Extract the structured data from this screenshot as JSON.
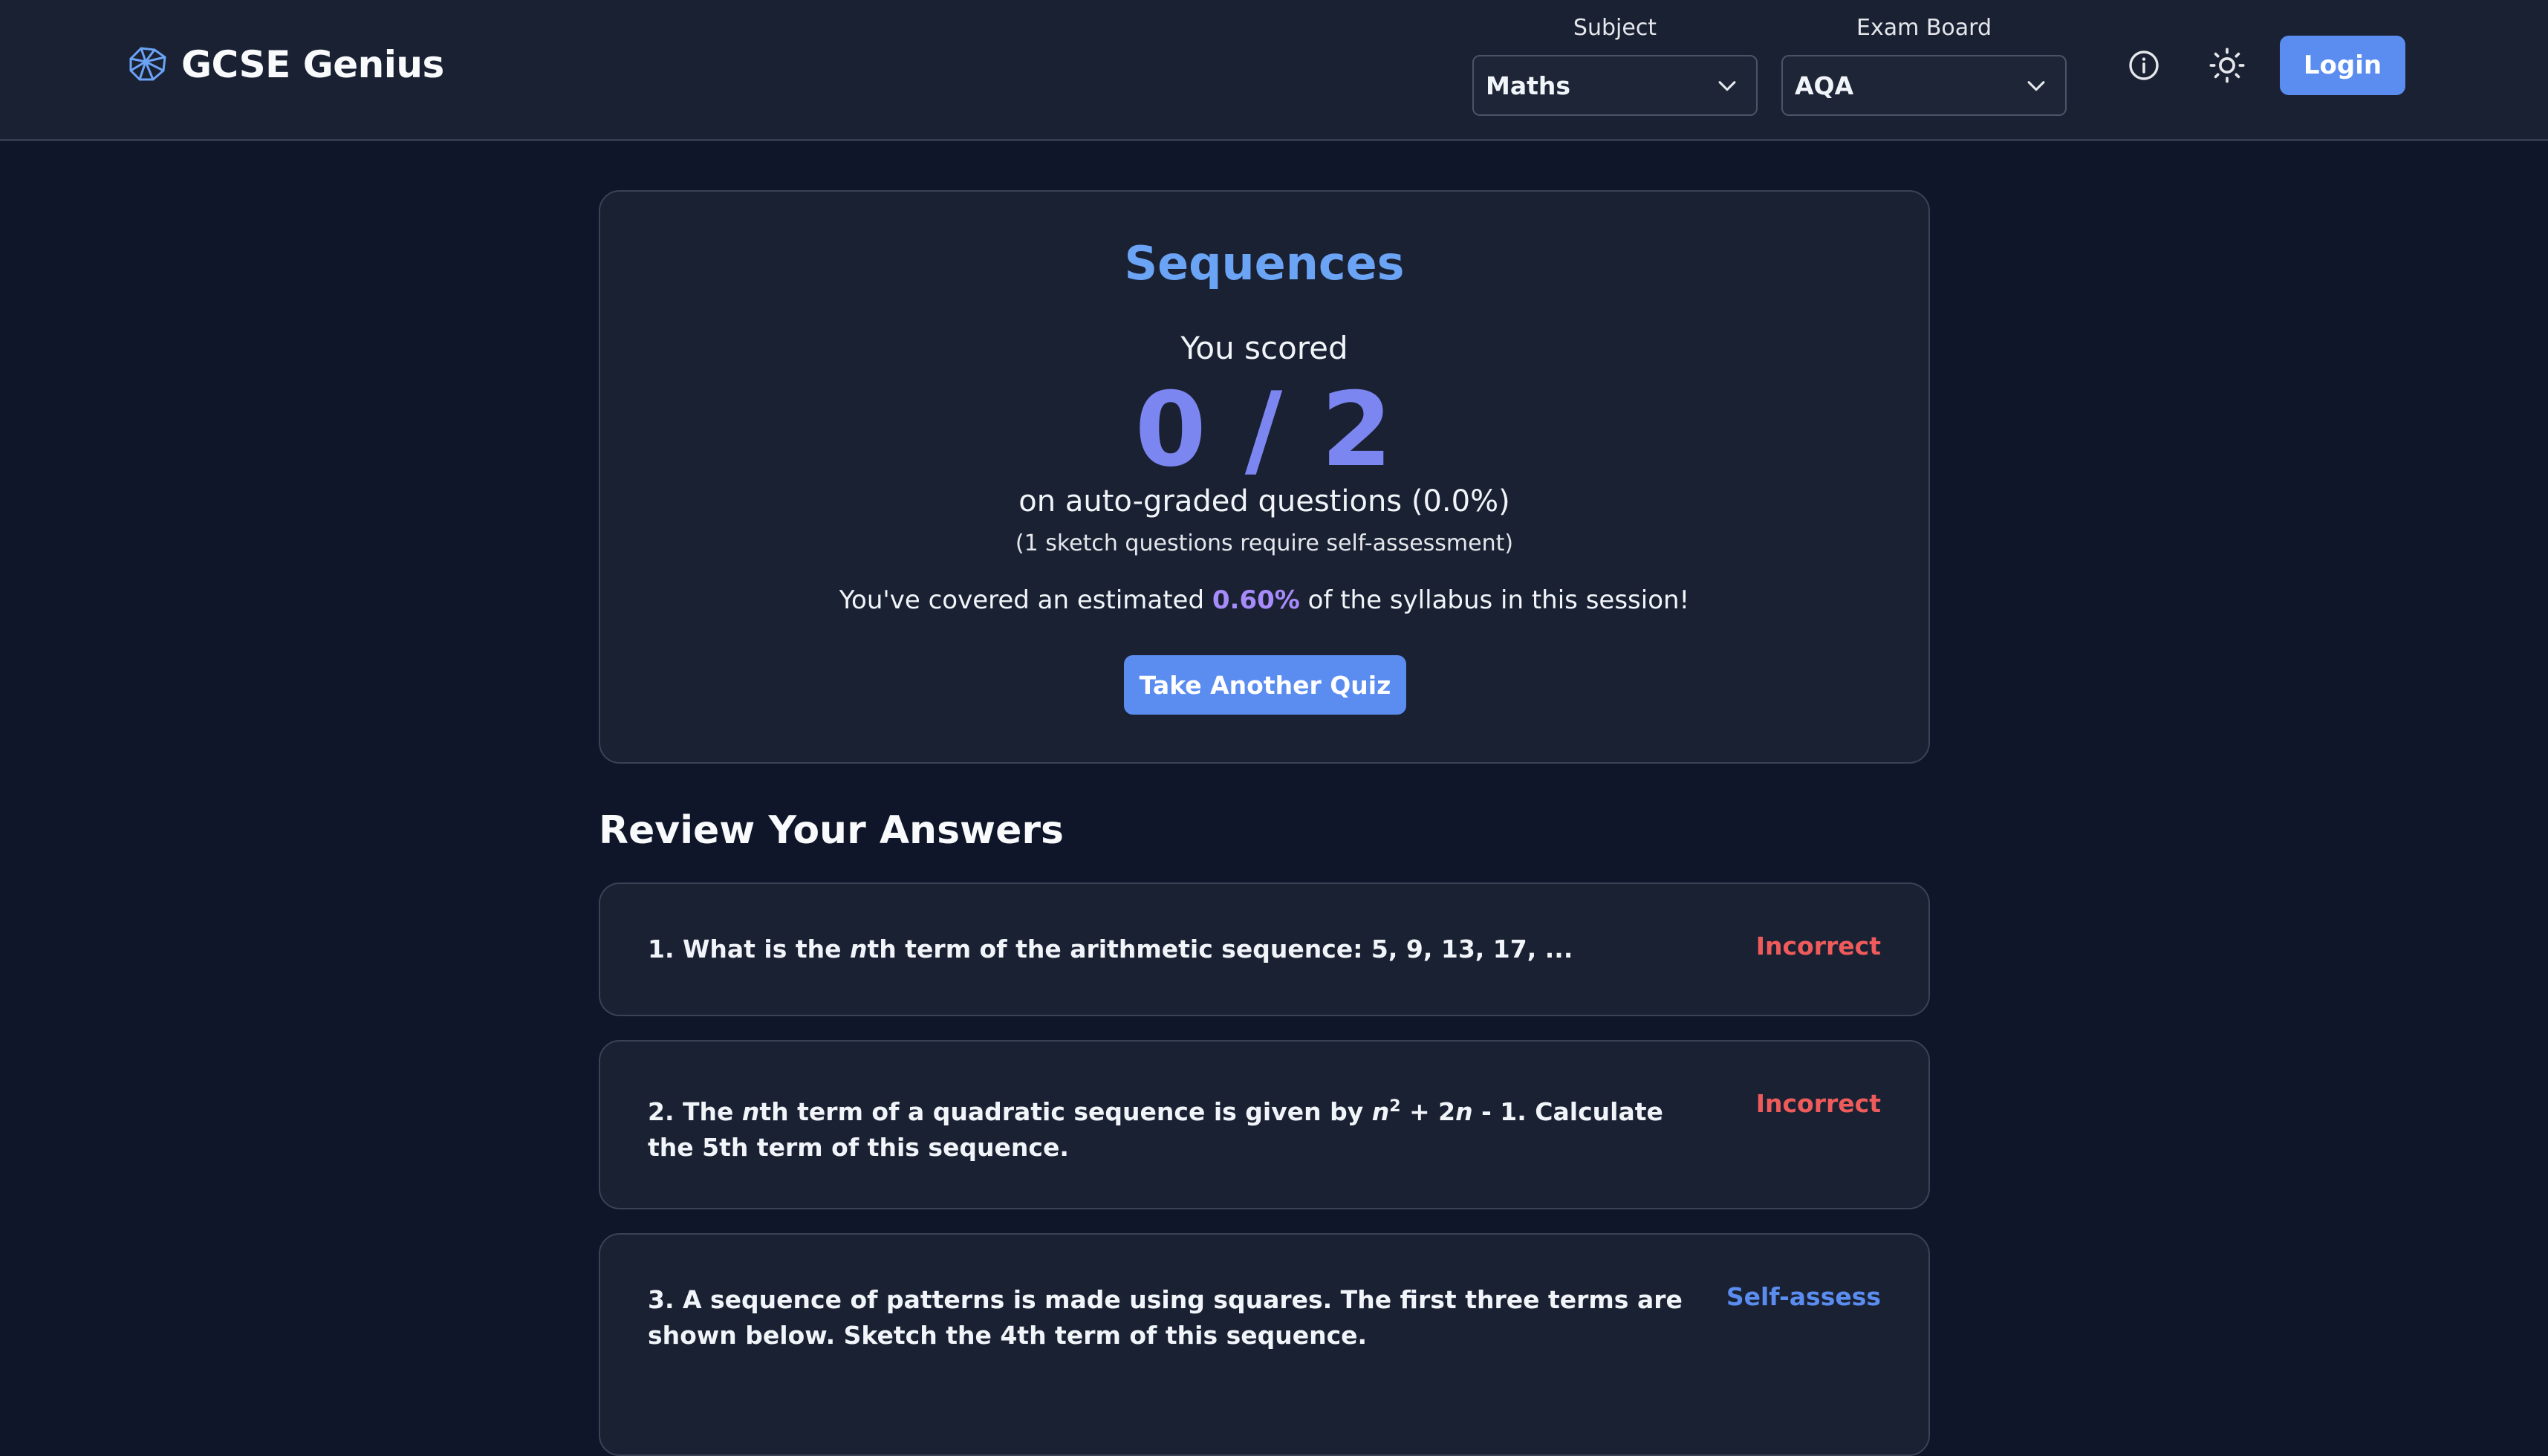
{
  "header": {
    "brand": "GCSE Genius",
    "subject_label": "Subject",
    "subject_value": "Maths",
    "board_label": "Exam Board",
    "board_value": "AQA",
    "login": "Login"
  },
  "result": {
    "topic": "Sequences",
    "you_scored": "You scored",
    "score": "0 / 2",
    "score_sub": "on auto-graded questions (0.0%)",
    "score_note": "(1 sketch questions require self-assessment)",
    "coverage_before": "You've covered an estimated ",
    "coverage_pct": "0.60%",
    "coverage_after": " of the syllabus in this session!",
    "take_another": "Take Another Quiz"
  },
  "review": {
    "heading": "Review Your Answers",
    "questions": [
      {
        "part1": "1. What is the ",
        "var1": "n",
        "part2": "th term of the arithmetic sequence: 5, 9, 13, 17, ...",
        "status": "Incorrect"
      },
      {
        "part1": "2. The ",
        "var1": "n",
        "part2": "th term of a quadratic sequence is given by ",
        "var2": "n",
        "sup": "2",
        "part3": " + 2",
        "var3": "n",
        "part4": " - 1. Calculate the 5th term of this sequence.",
        "status": "Incorrect"
      },
      {
        "text": "3. A sequence of patterns is made using squares. The first three terms are shown below. Sketch the 4th term of this sequence.",
        "status": "Self-assess"
      }
    ]
  },
  "colors": {
    "accent": "#5b8df0",
    "incorrect": "#ef5b5b",
    "score": "#7c86f0",
    "coverage": "#a78bfa"
  }
}
